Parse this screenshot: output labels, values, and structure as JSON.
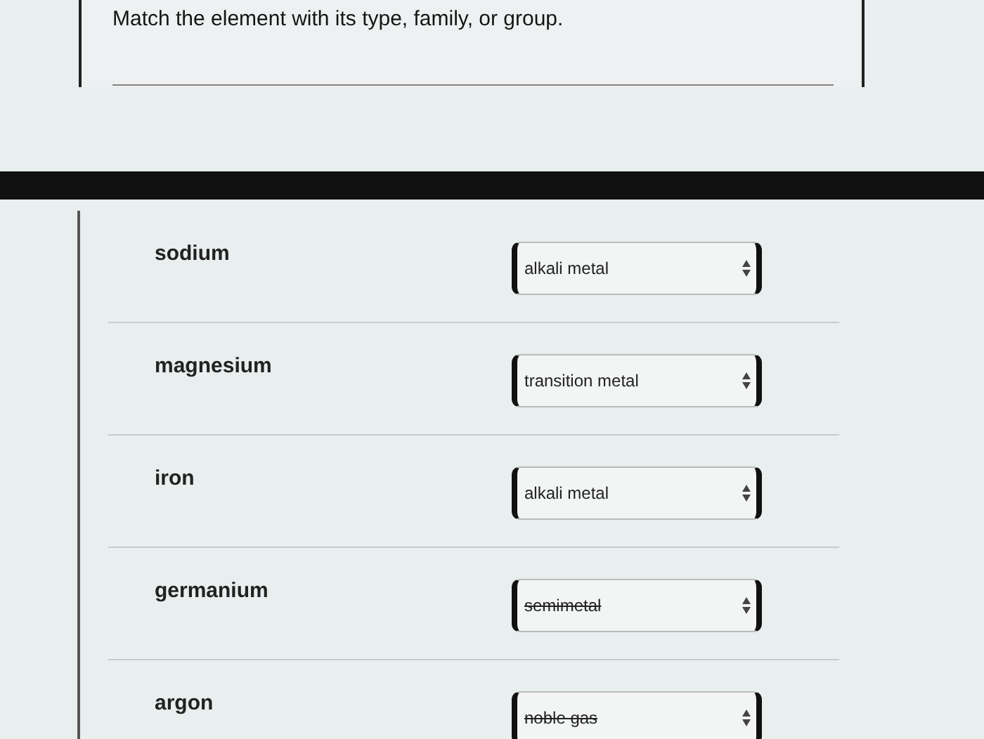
{
  "question": {
    "prompt": "Match the element with its type, family, or group."
  },
  "rows": [
    {
      "element": "sodium",
      "answer": "alkali metal",
      "struck": false
    },
    {
      "element": "magnesium",
      "answer": "transition metal",
      "struck": false
    },
    {
      "element": "iron",
      "answer": "alkali metal",
      "struck": false
    },
    {
      "element": "germanium",
      "answer": "semimetal",
      "struck": true
    },
    {
      "element": "argon",
      "answer": "noble gas",
      "struck": true
    }
  ]
}
